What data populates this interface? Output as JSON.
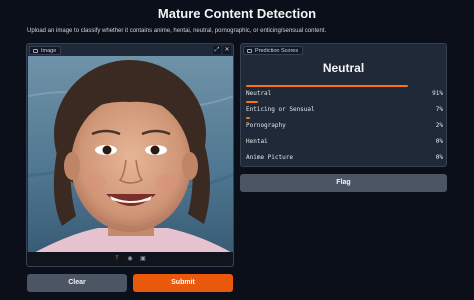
{
  "header": {
    "title": "Mature Content Detection",
    "description": "Upload an image to classify whether it contains anime, hentai, neutral, pornographic, or enticing/sensual content."
  },
  "image_panel": {
    "label": "Image",
    "tool_icons": [
      "fullscreen-icon",
      "close-icon"
    ],
    "footer_icons": [
      "upload-icon",
      "webcam-icon",
      "clipboard-icon"
    ]
  },
  "buttons": {
    "clear": "Clear",
    "submit": "Submit",
    "flag": "Flag"
  },
  "prediction": {
    "label": "Prediction Scores",
    "top_label": "Neutral",
    "scores": [
      {
        "name": "Neutral",
        "pct": "91%",
        "value": 0.91
      },
      {
        "name": "Enticing or Sensual",
        "pct": "7%",
        "value": 0.07
      },
      {
        "name": "Pornography",
        "pct": "2%",
        "value": 0.02
      },
      {
        "name": "Hentai",
        "pct": "0%",
        "value": 0.0
      },
      {
        "name": "Anime Picture",
        "pct": "0%",
        "value": 0.0
      }
    ]
  },
  "colors": {
    "background": "#0b0f19",
    "panel": "#1f2937",
    "accent": "#ea580c",
    "bar": "#f97316",
    "secondary_button": "#4b5563"
  }
}
